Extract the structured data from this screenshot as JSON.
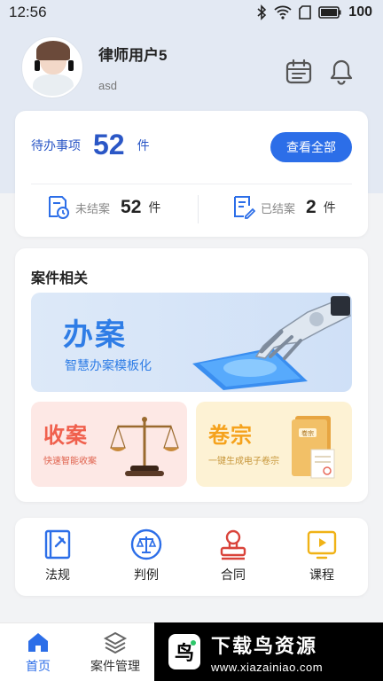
{
  "status_bar": {
    "time": "12:56",
    "battery": "100"
  },
  "user": {
    "name": "律师用户5",
    "account": "asd"
  },
  "todo": {
    "label": "待办事项",
    "count": "52",
    "unit": "件",
    "view_all": "查看全部",
    "open_label": "未结案",
    "open_count": "52",
    "open_unit": "件",
    "closed_label": "已结案",
    "closed_count": "2",
    "closed_unit": "件"
  },
  "cases": {
    "title": "案件相关",
    "main_banner": {
      "title": "办案",
      "subtitle": "智慧办案模板化"
    },
    "receive_banner": {
      "title": "收案",
      "subtitle": "快速智能收案"
    },
    "archive_banner": {
      "title": "卷宗",
      "subtitle": "一键生成电子卷宗",
      "folder_text": "卷宗"
    }
  },
  "tools": [
    {
      "label": "法规",
      "icon": "law-book-icon"
    },
    {
      "label": "判例",
      "icon": "scale-icon"
    },
    {
      "label": "合同",
      "icon": "stamp-icon"
    },
    {
      "label": "课程",
      "icon": "play-icon"
    }
  ],
  "nav": {
    "home": "首页",
    "cases": "案件管理"
  },
  "watermark": {
    "title": "下载鸟资源",
    "url": "www.xiazainiao.com",
    "logo_char": "鸟"
  },
  "colors": {
    "accent": "#2c6ee8",
    "header_bg": "#e3e9f3",
    "receive": "#f0604d",
    "archive": "#f5a21c"
  }
}
